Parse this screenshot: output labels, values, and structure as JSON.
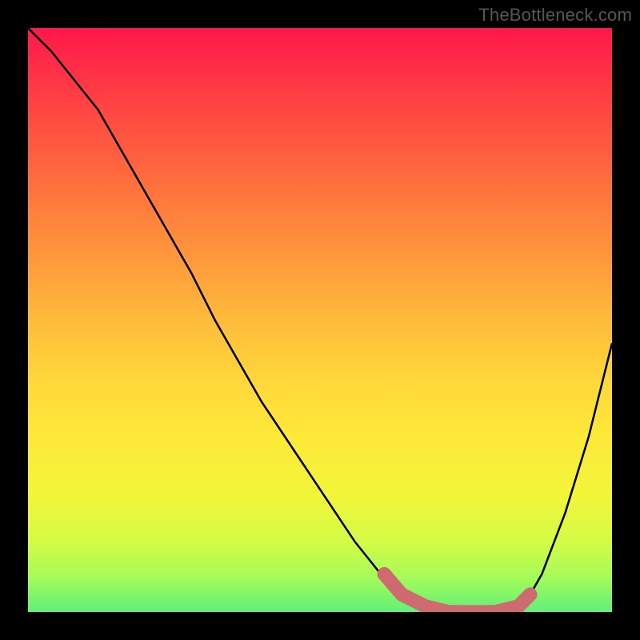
{
  "watermark": "TheBottleneck.com",
  "chart_data": {
    "type": "line",
    "title": "",
    "xlabel": "",
    "ylabel": "",
    "xlim": [
      0,
      100
    ],
    "ylim": [
      0,
      100
    ],
    "grid": false,
    "legend": false,
    "annotations": [],
    "series": [
      {
        "name": "bottleneck-curve",
        "color": "#000000",
        "x": [
          0,
          4,
          8,
          12,
          16,
          20,
          24,
          28,
          32,
          36,
          40,
          44,
          48,
          52,
          56,
          60,
          61,
          64,
          68,
          72,
          76,
          80,
          84,
          86,
          88,
          92,
          96,
          100
        ],
        "values": [
          100,
          96,
          91,
          86,
          79,
          72,
          65,
          58,
          50,
          43,
          36,
          30,
          24,
          18,
          12,
          7,
          6.5,
          3,
          1,
          0,
          0,
          0,
          1,
          3,
          6.5,
          17,
          30,
          46
        ]
      },
      {
        "name": "optimal-range-marker",
        "color": "#cf6a6e",
        "style": "thick-rounded",
        "x": [
          61,
          64,
          68,
          72,
          76,
          80,
          84,
          86
        ],
        "values": [
          6.5,
          3,
          1,
          0,
          0,
          0,
          1,
          3
        ]
      }
    ],
    "background_gradient_stops": [
      {
        "pos": 0,
        "color": "#ff174a"
      },
      {
        "pos": 7,
        "color": "#ff2f47"
      },
      {
        "pos": 18,
        "color": "#ff5340"
      },
      {
        "pos": 30,
        "color": "#ff7a3d"
      },
      {
        "pos": 40,
        "color": "#ff9a3c"
      },
      {
        "pos": 50,
        "color": "#ffbb3b"
      },
      {
        "pos": 60,
        "color": "#ffd63a"
      },
      {
        "pos": 70,
        "color": "#fde938"
      },
      {
        "pos": 80,
        "color": "#f2f53a"
      },
      {
        "pos": 88,
        "color": "#d4fb46"
      },
      {
        "pos": 94,
        "color": "#a6fb58"
      },
      {
        "pos": 100,
        "color": "#5ff07a"
      }
    ]
  }
}
